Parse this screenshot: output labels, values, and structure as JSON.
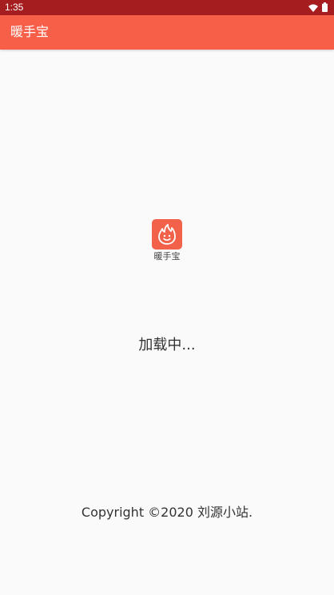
{
  "status_bar": {
    "time": "1:35",
    "icons": [
      "wifi-icon",
      "battery-icon"
    ],
    "background": "#a51d1f"
  },
  "app_bar": {
    "title": "暖手宝",
    "background": "#f85f49"
  },
  "splash": {
    "logo_label": "暖手宝",
    "logo_icon": "flame-smile-icon",
    "logo_color": "#f2624a",
    "loading_text": "加载中...",
    "copyright": "Copyright ©2020 刘源小站."
  }
}
